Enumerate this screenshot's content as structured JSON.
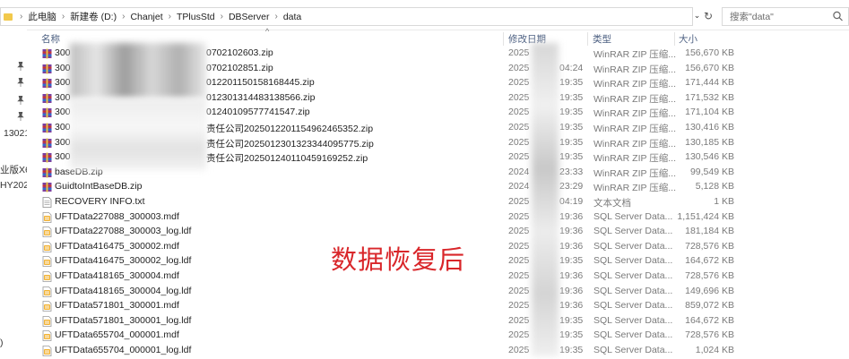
{
  "address": {
    "crumbs": [
      "此电脑",
      "新建卷 (D:)",
      "Chanjet",
      "TPlusStd",
      "DBServer",
      "data"
    ]
  },
  "search": {
    "placeholder": "搜索\"data\""
  },
  "nav": {
    "labels": [
      "13021",
      "业版X6",
      "HY202",
      ")"
    ]
  },
  "columns": {
    "name": "名称",
    "modified": "修改日期",
    "type": "类型",
    "size": "大小"
  },
  "files": [
    {
      "name": "300",
      "name_tail": "0702102603.zip",
      "date": "2025",
      "time": "",
      "type": "WinRAR ZIP 压缩...",
      "size": "156,670 KB",
      "icon": "winrar-icon"
    },
    {
      "name": "300",
      "name_tail": "0702102851.zip",
      "date": "2025",
      "time": "04:24",
      "type": "WinRAR ZIP 压缩...",
      "size": "156,670 KB",
      "icon": "winrar-icon"
    },
    {
      "name": "300",
      "name_tail": "01220115015816​8445.zip",
      "date": "2025",
      "time": "19:35",
      "type": "WinRAR ZIP 压缩...",
      "size": "171,444 KB",
      "icon": "winrar-icon"
    },
    {
      "name": "300",
      "name_tail": "012301314483138566.zip",
      "date": "2025",
      "time": "19:35",
      "type": "WinRAR ZIP 压缩...",
      "size": "171,532 KB",
      "icon": "winrar-icon"
    },
    {
      "name": "300",
      "name_tail": "01240109577741547.zip",
      "date": "2025",
      "time": "19:35",
      "type": "WinRAR ZIP 压缩...",
      "size": "171,104 KB",
      "icon": "winrar-icon"
    },
    {
      "name": "300",
      "name_tail": "责任公司20250122011549624653​52.zip",
      "date": "2025",
      "time": "19:35",
      "type": "WinRAR ZIP 压缩...",
      "size": "130,416 KB",
      "icon": "winrar-icon"
    },
    {
      "name": "300",
      "name_tail": "责任公司20250123013233440957​75.zip",
      "date": "2025",
      "time": "19:35",
      "type": "WinRAR ZIP 压缩...",
      "size": "130,185 KB",
      "icon": "winrar-icon"
    },
    {
      "name": "300",
      "name_tail": "责任公司20250124011045916925​2.zip",
      "date": "2025",
      "time": "19:35",
      "type": "WinRAR ZIP 压缩...",
      "size": "130,546 KB",
      "icon": "winrar-icon"
    },
    {
      "name": "baseDB.zip",
      "name_tail": "",
      "date": "2024",
      "time": "23:33",
      "type": "WinRAR ZIP 压缩...",
      "size": "99,549 KB",
      "icon": "winrar-icon"
    },
    {
      "name": "GuidtoIntBaseDB.zip",
      "name_tail": "",
      "date": "2024",
      "time": "23:29",
      "type": "WinRAR ZIP 压缩...",
      "size": "5,128 KB",
      "icon": "winrar-icon"
    },
    {
      "name": "RECOVERY INFO.txt",
      "name_tail": "",
      "date": "2025",
      "time": "04:19",
      "type": "文本文档",
      "size": "1 KB",
      "icon": "text-file-icon"
    },
    {
      "name": "UFTData227088_300003.mdf",
      "name_tail": "",
      "date": "2025",
      "time": "19:36",
      "type": "SQL Server Data...",
      "size": "1,151,424 KB",
      "icon": "sql-data-icon"
    },
    {
      "name": "UFTData227088_300003_log.ldf",
      "name_tail": "",
      "date": "2025",
      "time": "19:36",
      "type": "SQL Server Data...",
      "size": "181,184 KB",
      "icon": "sql-data-icon"
    },
    {
      "name": "UFTData416475_300002.mdf",
      "name_tail": "",
      "date": "2025",
      "time": "19:36",
      "type": "SQL Server Data...",
      "size": "728,576 KB",
      "icon": "sql-data-icon"
    },
    {
      "name": "UFTData416475_300002_log.ldf",
      "name_tail": "",
      "date": "2025",
      "time": "19:35",
      "type": "SQL Server Data...",
      "size": "164,672 KB",
      "icon": "sql-data-icon"
    },
    {
      "name": "UFTData418165_300004.mdf",
      "name_tail": "",
      "date": "2025",
      "time": "19:36",
      "type": "SQL Server Data...",
      "size": "728,576 KB",
      "icon": "sql-data-icon"
    },
    {
      "name": "UFTData418165_300004_log.ldf",
      "name_tail": "",
      "date": "2025",
      "time": "19:36",
      "type": "SQL Server Data...",
      "size": "149,696 KB",
      "icon": "sql-data-icon"
    },
    {
      "name": "UFTData571801_300001.mdf",
      "name_tail": "",
      "date": "2025",
      "time": "19:36",
      "type": "SQL Server Data...",
      "size": "859,072 KB",
      "icon": "sql-data-icon"
    },
    {
      "name": "UFTData571801_300001_log.ldf",
      "name_tail": "",
      "date": "2025",
      "time": "19:35",
      "type": "SQL Server Data...",
      "size": "164,672 KB",
      "icon": "sql-data-icon"
    },
    {
      "name": "UFTData655704_000001.mdf",
      "name_tail": "",
      "date": "2025",
      "time": "19:35",
      "type": "SQL Server Data...",
      "size": "728,576 KB",
      "icon": "sql-data-icon"
    },
    {
      "name": "UFTData655704_000001_log.ldf",
      "name_tail": "",
      "date": "2025",
      "time": "19:35",
      "type": "SQL Server Data...",
      "size": "1,024 KB",
      "icon": "sql-data-icon"
    }
  ],
  "overlay": {
    "text": "数据恢复后"
  },
  "colors": {
    "header_text": "#4d6082",
    "meta_text": "#7a7a7a",
    "overlay_red": "#d9262a",
    "sql_icon": "#f2b233",
    "zip_icon": "#7a3fa0"
  }
}
